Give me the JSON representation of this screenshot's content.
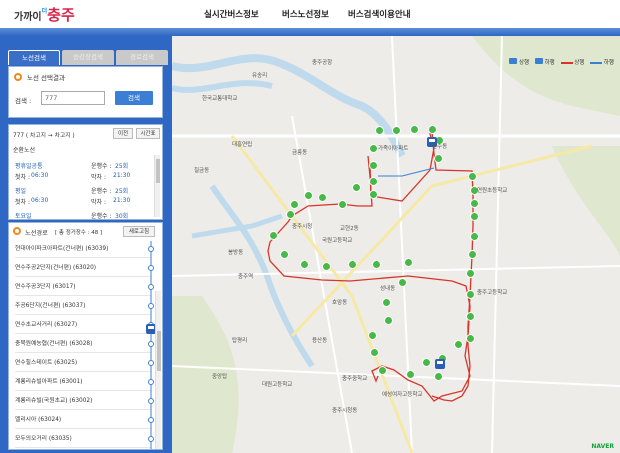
{
  "header": {
    "logo_small": "가까이",
    "logo_sup": "더",
    "logo_big": "충주",
    "nav": [
      "실시간버스정보",
      "버스노선정보",
      "버스검색이용안내"
    ]
  },
  "tabs": [
    "노선검색",
    "승강장검색",
    "경로검색"
  ],
  "search": {
    "title": "노선 선택결과",
    "label": "검색 :",
    "value": "777",
    "button": "검색"
  },
  "route": {
    "summary": "777 ( 차고지 → 차고지 )",
    "prev_button": "이전",
    "timetable_button": "시간표",
    "type": "순환노선",
    "schedules": [
      {
        "day": "평휴일공통",
        "count_label": "운행수 :",
        "count": "25회",
        "first_label": "첫차 :",
        "first": "06:30",
        "last_label": "막차 :",
        "last": "21:30"
      },
      {
        "day": "평일",
        "count_label": "운행수 :",
        "count": "25회",
        "first_label": "첫차 :",
        "first": "06:30",
        "last_label": "막차 :",
        "last": "21:30"
      },
      {
        "day": "토요일",
        "count_label": "운행수 :",
        "count": "30회"
      }
    ]
  },
  "path": {
    "title": "노선경로",
    "count_text": "[ 총 정거장수 : 48 ]",
    "refresh_button": "새로고침",
    "stops": [
      "현대아이파크아파트(건너편) (63039)",
      "연수주공2단지(건너편) (63020)",
      "연수주공3단지 (63017)",
      "주공6단지(건너편) (63037)",
      "연수초교사거리 (63027)",
      "충북원예농협(건너편) (63028)",
      "연수힐스테이트 (63025)",
      "계룡리슈빌아파트 (63001)",
      "계룡리슈빌(국원초교) (63002)",
      "엘리시아 (63024)",
      "모두의오거리 (63035)"
    ]
  },
  "legend": {
    "up": "상행",
    "down": "하행",
    "up_line": "상행",
    "down_line": "하행",
    "colors": {
      "up": "#d9342b",
      "down": "#3b7fd4"
    }
  },
  "map_labels": [
    "유송리",
    "한국교통대학교",
    "충주공항",
    "가족이아파트",
    "연수동",
    "대흥연립",
    "충주시청",
    "교현2동",
    "봉방동",
    "성내동",
    "충주역",
    "호암동",
    "칠금동",
    "금릉동",
    "연원초등학교",
    "충주고등학교",
    "충주중학교",
    "용산동",
    "국원고등학교",
    "예성여자고등학교",
    "중앙탑",
    "충주시청동",
    "탑평리",
    "대원고등학교"
  ],
  "naver": "NAVER"
}
